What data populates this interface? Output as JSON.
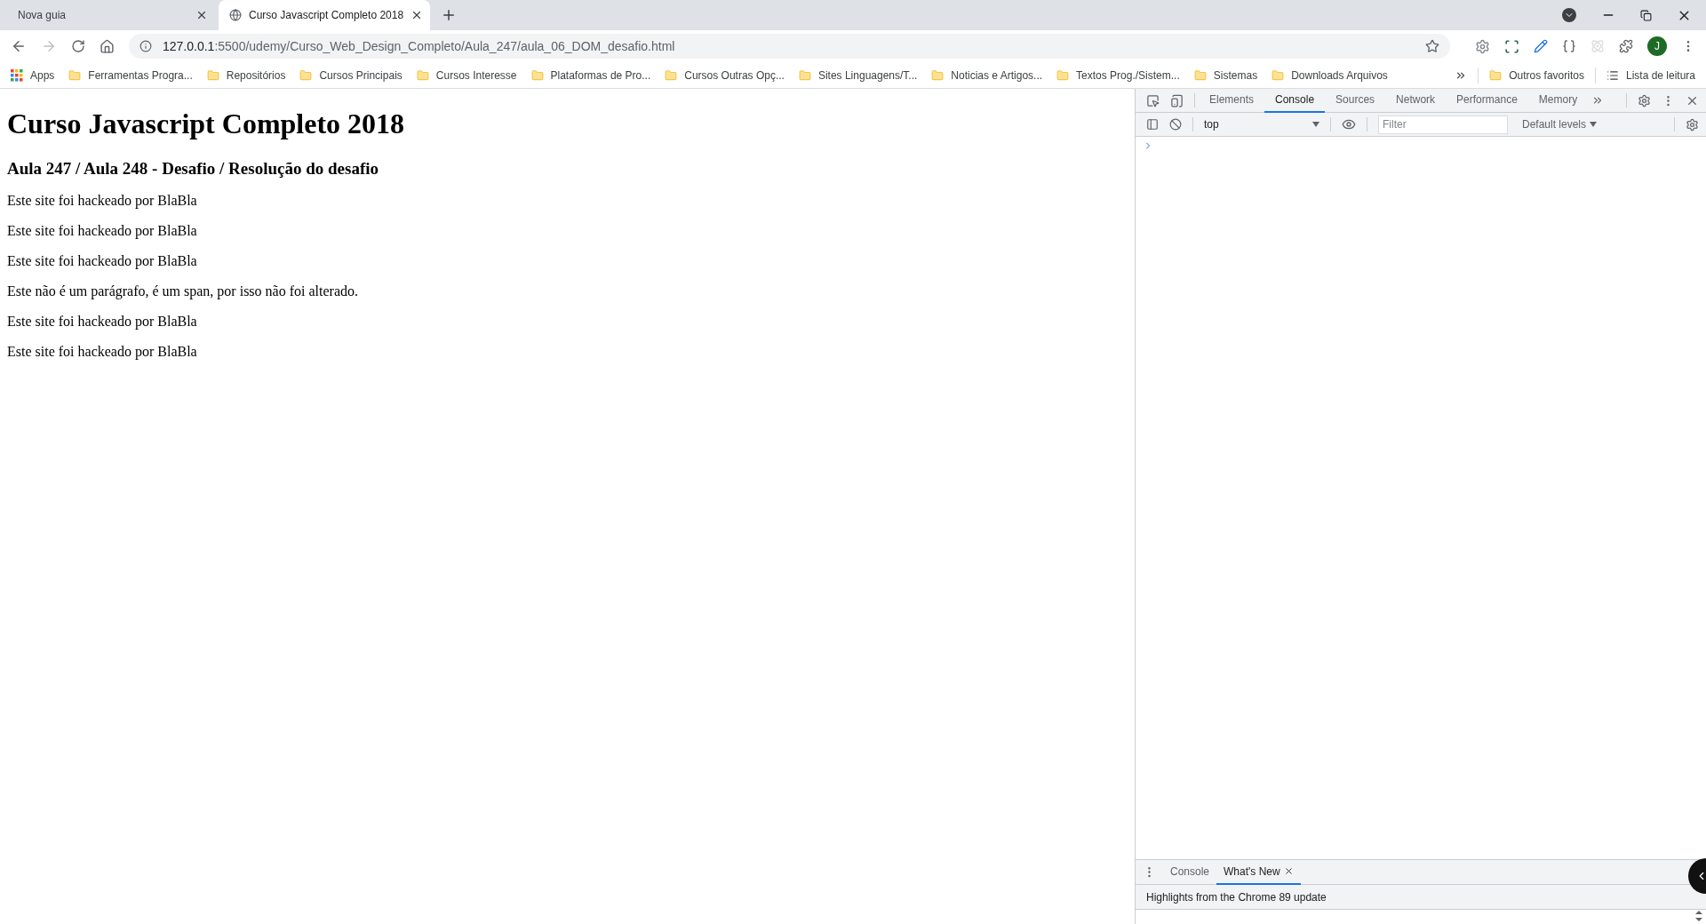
{
  "browser_tabs": [
    {
      "title": "Nova guia",
      "selected": false
    },
    {
      "title": "Curso Javascript Completo 2018",
      "selected": true
    }
  ],
  "address_bar": {
    "host": "127.0.0.1",
    "path": ":5500/udemy/Curso_Web_Design_Completo/Aula_247/aula_06_DOM_desafio.html"
  },
  "profile_initial": "J",
  "bookmarks": {
    "apps": "Apps",
    "items": [
      "Ferramentas Progra...",
      "Repositórios",
      "Cursos Principais",
      "Cursos Interesse",
      "Plataformas de Pro...",
      "Cursos Outras Opç...",
      "Sites Linguagens/T...",
      "Noticias e Artigos...",
      "Textos Prog./Sistem...",
      "Sistemas",
      "Downloads Arquivos"
    ],
    "other": "Outros favoritos",
    "reading_list": "Lista de leitura"
  },
  "page": {
    "heading": "Curso Javascript Completo 2018",
    "subheading": "Aula 247 / Aula 248 - Desafio / Resolução do desafio",
    "paragraphs": [
      "Este site foi hackeado por BlaBla",
      "Este site foi hackeado por BlaBla",
      "Este site foi hackeado por BlaBla",
      "Este não é um parágrafo, é um span, por isso não foi alterado.",
      "Este site foi hackeado por BlaBla",
      "Este site foi hackeado por BlaBla"
    ]
  },
  "devtools": {
    "tabs": [
      {
        "label": "Elements",
        "selected": false
      },
      {
        "label": "Console",
        "selected": true
      },
      {
        "label": "Sources",
        "selected": false
      },
      {
        "label": "Network",
        "selected": false
      },
      {
        "label": "Performance",
        "selected": false
      },
      {
        "label": "Memory",
        "selected": false
      }
    ],
    "context": "top",
    "filter_placeholder": "Filter",
    "levels": "Default levels",
    "drawer_tabs": [
      {
        "label": "Console",
        "selected": false,
        "closable": false
      },
      {
        "label": "What's New",
        "selected": true,
        "closable": true
      }
    ],
    "whats_new_text": "Highlights from the Chrome 89 update"
  }
}
